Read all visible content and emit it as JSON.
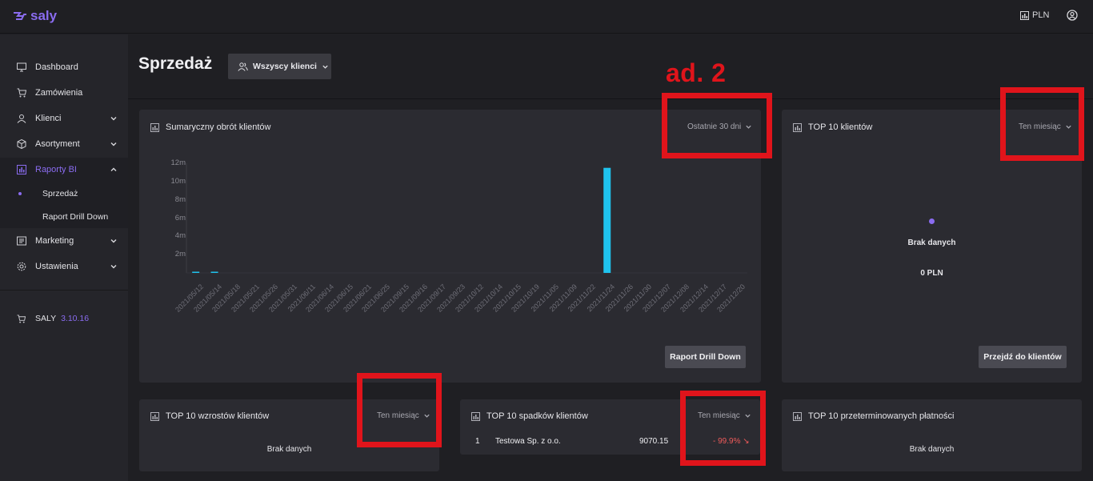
{
  "app": {
    "logo": "saly",
    "currency": "PLN"
  },
  "sidebar": {
    "items": [
      {
        "label": "Dashboard",
        "icon": "monitor-icon"
      },
      {
        "label": "Zamówienia",
        "icon": "cart-icon"
      },
      {
        "label": "Klienci",
        "icon": "user-icon"
      },
      {
        "label": "Asortyment",
        "icon": "box-icon"
      },
      {
        "label": "Raporty BI",
        "icon": "report-icon"
      },
      {
        "label": "Marketing",
        "icon": "megaphone-icon"
      },
      {
        "label": "Ustawienia",
        "icon": "gear-icon"
      }
    ],
    "sub_items": [
      {
        "label": "Sprzedaż"
      },
      {
        "label": "Raport Drill Down"
      }
    ],
    "version_label": "SALY",
    "version_number": "3.10.16"
  },
  "header": {
    "title": "Sprzedaż",
    "client_select": "Wszyscy klienci"
  },
  "annotation": {
    "label": "ad. 2"
  },
  "cards": {
    "turnover": {
      "title": "Sumaryczny obrót klientów",
      "filter": "Ostatnie 30 dni",
      "button": "Raport Drill Down"
    },
    "top10": {
      "title": "TOP 10 klientów",
      "filter": "Ten miesiąc",
      "nodata": "Brak danych",
      "total": "0 PLN",
      "button": "Przejdź do klientów"
    },
    "growth": {
      "title": "TOP 10 wzrostów klientów",
      "filter": "Ten miesiąc",
      "nodata": "Brak danych"
    },
    "decline": {
      "title": "TOP 10 spadków klientów",
      "filter": "Ten miesiąc",
      "rows": [
        {
          "rank": "1",
          "name": "Testowa Sp. z o.o.",
          "value": "9070.15",
          "change": "- 99.9% ↘"
        }
      ]
    },
    "overdue": {
      "title": "TOP 10 przeterminowanych płatności",
      "nodata": "Brak danych"
    }
  },
  "colors": {
    "accent": "#8a6cf0",
    "bar": "#1fc3ee",
    "annotation": "#e0141b",
    "decline": "#ef5b5b"
  },
  "chart_data": {
    "type": "bar",
    "categories": [
      "2021/05/12",
      "2021/05/14",
      "2021/05/18",
      "2021/05/21",
      "2021/05/26",
      "2021/05/31",
      "2021/06/11",
      "2021/06/14",
      "2021/06/15",
      "2021/06/21",
      "2021/06/25",
      "2021/09/15",
      "2021/09/16",
      "2021/09/17",
      "2021/09/23",
      "2021/10/12",
      "2021/10/14",
      "2021/10/15",
      "2021/10/19",
      "2021/11/05",
      "2021/11/09",
      "2021/11/22",
      "2021/11/24",
      "2021/11/26",
      "2021/11/30",
      "2021/12/07",
      "2021/12/08",
      "2021/12/14",
      "2021/12/17",
      "2021/12/20"
    ],
    "values": [
      70000,
      50000,
      0,
      0,
      0,
      0,
      0,
      0,
      0,
      0,
      0,
      0,
      0,
      0,
      0,
      0,
      0,
      0,
      0,
      0,
      0,
      0,
      11500000,
      0,
      0,
      0,
      0,
      0,
      0,
      0
    ],
    "yticks": [
      "2m",
      "4m",
      "6m",
      "8m",
      "10m",
      "12m"
    ],
    "ylim": [
      0,
      12000000
    ],
    "title": "",
    "xlabel": "",
    "ylabel": ""
  }
}
